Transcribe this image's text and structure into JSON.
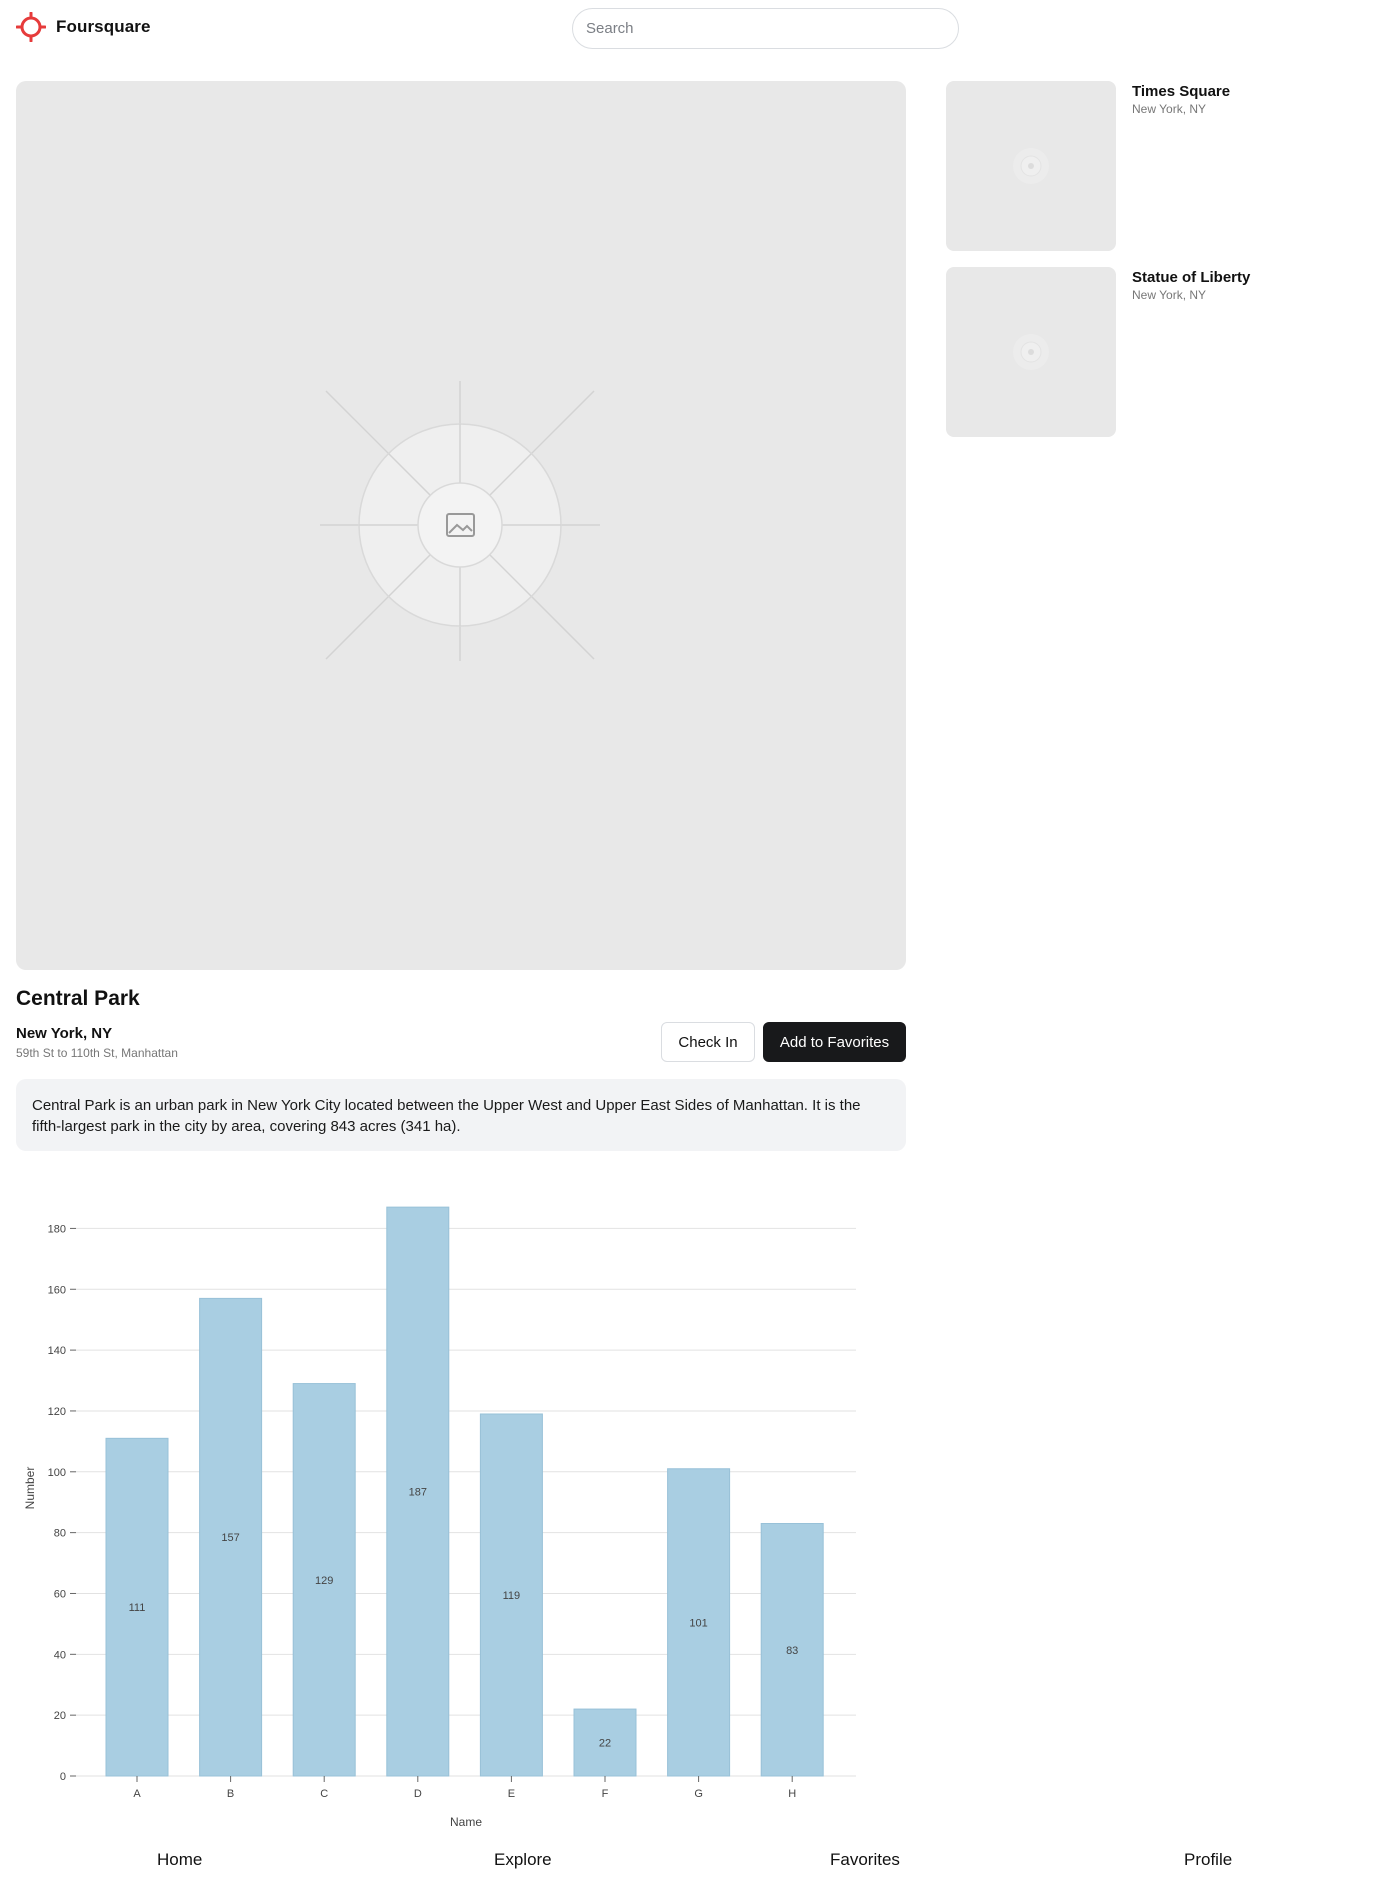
{
  "header": {
    "brand": "Foursquare",
    "search_placeholder": "Search"
  },
  "place": {
    "title": "Central Park",
    "city": "New York, NY",
    "address": "59th St to 110th St, Manhattan",
    "description": "Central Park is an urban park in New York City located between the Upper West and Upper East Sides of Manhattan. It is the fifth-largest park in the city by area, covering 843 acres (341 ha).",
    "checkin_label": "Check In",
    "favorite_label": "Add to Favorites"
  },
  "related": [
    {
      "name": "Times Square",
      "location": "New York, NY"
    },
    {
      "name": "Statue of Liberty",
      "location": "New York, NY"
    }
  ],
  "nav": {
    "items": [
      "Home",
      "Explore",
      "Favorites",
      "Profile"
    ]
  },
  "colors": {
    "brand": "#e63b3b",
    "bar": "#a9cee2",
    "primary_button": "#18191b"
  },
  "chart_data": {
    "type": "bar",
    "categories": [
      "A",
      "B",
      "C",
      "D",
      "E",
      "F",
      "G",
      "H"
    ],
    "values": [
      111,
      157,
      129,
      187,
      119,
      22,
      101,
      83
    ],
    "xlabel": "Name",
    "ylabel": "Number",
    "ylim": [
      0,
      190
    ],
    "yticks": [
      0,
      20,
      40,
      60,
      80,
      100,
      120,
      140,
      160,
      180
    ],
    "grid": true,
    "data_labels": true
  }
}
